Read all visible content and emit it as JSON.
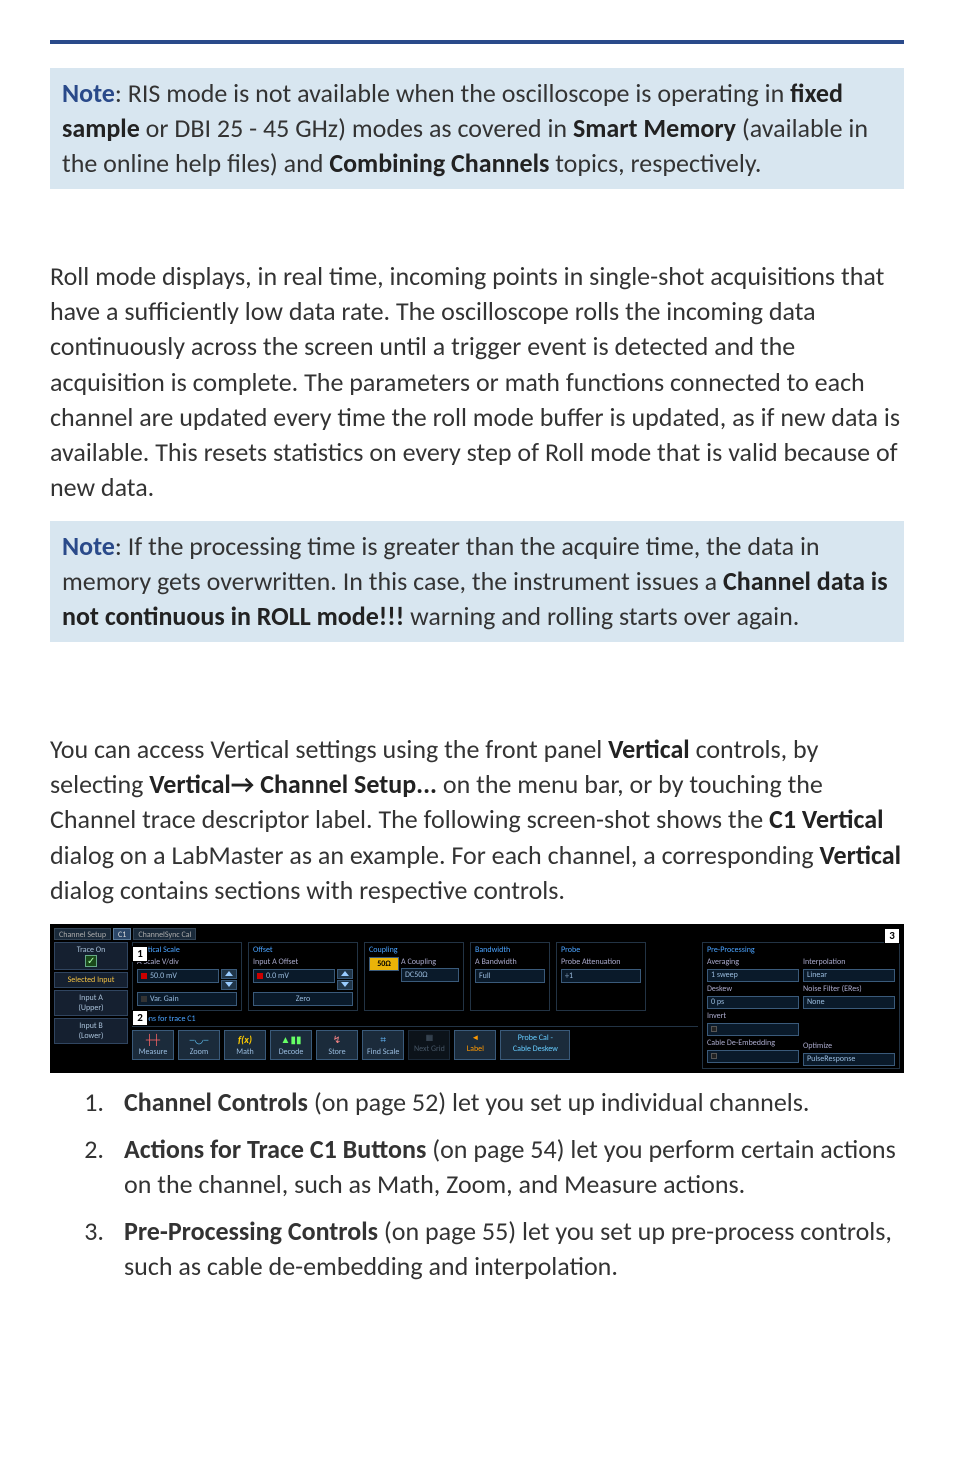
{
  "note1": {
    "label": "Note",
    "text_a": ": RIS mode is not available when the oscilloscope is operating in ",
    "bold_a": "fixed sample",
    "text_b": " or DBI 25 - 45 GHz) modes as covered in ",
    "bold_b": "Smart Memory",
    "text_c": " (available in the online help files) and ",
    "bold_c": "Combining Channels",
    "text_d": " topics, respectively."
  },
  "para_roll": "Roll mode displays, in real time, incoming points in single-shot acquisitions that have a sufficiently low data rate. The oscilloscope rolls the incoming data continuously across the screen until a trigger event is detected and the acquisition is complete. The parameters or math functions connected to each channel are updated every time the roll mode buffer is updated, as if new data is available. This resets statistics on every step of Roll mode that is valid because of new data.",
  "note2": {
    "label": "Note",
    "text_a": ": If the processing time is greater than the acquire time, the data in memory gets overwritten. In this case, the instrument issues a ",
    "bold_a": "Channel data is not continuous in ROLL mode!!!",
    "text_b": " warning and rolling starts over again."
  },
  "vert_intro": {
    "pre": "You can access Vertical settings using the front panel ",
    "b1": "Vertical",
    "mid1": " controls, by selecting ",
    "b2": "Vertical→ Channel Setup...",
    "mid2": " on the menu bar, or by touching the Channel trace descriptor label. The following screen-shot shows the ",
    "b3": "C1 Vertical",
    "mid3": " dialog on a LabMaster as an example. For each channel, a corresponding ",
    "b4": "Vertical",
    "tail": " dialog contains sections with respective controls."
  },
  "ui": {
    "tabs": {
      "channel_setup": "Channel Setup",
      "c1": "C1",
      "sync": "ChannelSync Cal"
    },
    "callouts": {
      "one": "1",
      "two": "2",
      "three": "3"
    },
    "left": {
      "trace_on": "Trace On",
      "selected_input": "Selected Input",
      "input_a": "Input A",
      "upper": "(Upper)",
      "input_b": "Input B",
      "lower": "(Lower)"
    },
    "vertical_scale": {
      "title": "Vertical Scale",
      "a_scale": "A Scale V/div",
      "a_scale_val": "50.0 mV",
      "var_gain": "Var. Gain"
    },
    "offset": {
      "title": "Offset",
      "a_offset": "Input A Offset",
      "a_offset_val": "0.0 mV",
      "zero": "Zero"
    },
    "coupling": {
      "title": "Coupling",
      "fifty": "50Ω",
      "a_coupling": "A Coupling",
      "a_coupling_val": "DC50Ω"
    },
    "bandwidth": {
      "title": "Bandwidth",
      "a_bw": "A Bandwidth",
      "a_bw_val": "Full"
    },
    "probe": {
      "title": "Probe",
      "atten": "Probe Attenuation",
      "atten_val": "÷1"
    },
    "actions": {
      "title": "Actions for trace C1",
      "measure": "Measure",
      "zoom": "Zoom",
      "math_top": "f(x)",
      "math": "Math",
      "decode": "Decode",
      "store": "Store",
      "find_scale": "Find Scale",
      "next_grid": "Next Grid",
      "label": "Label",
      "probe_cal": "Probe Cal -",
      "cable_deskew": "Cable Deskew"
    },
    "preproc": {
      "title": "Pre-Processing",
      "averaging": "Averaging",
      "averaging_val": "1 sweep",
      "deskew": "Deskew",
      "deskew_val": "0 ps",
      "invert": "Invert",
      "cable_de": "Cable De-Embedding",
      "interpolation": "Interpolation",
      "interp_val": "Linear",
      "noise_filter": "Noise Filter (ERes)",
      "noise_val": "None",
      "optimize": "Optimize",
      "pulseresp": "PulseResponse"
    }
  },
  "list": {
    "n1": "1.",
    "i1_b": "Channel Controls",
    "i1_t": " (on page 52) let you set up individual channels.",
    "n2": "2.",
    "i2_b": "Actions for Trace C1 Buttons",
    "i2_t": " (on page 54) let you perform certain actions on the channel, such as Math, Zoom, and Measure actions.",
    "n3": "3.",
    "i3_b": "Pre-Processing Controls",
    "i3_t": " (on page 55) let you set up pre-process controls, such as cable de-embedding and interpolation."
  }
}
